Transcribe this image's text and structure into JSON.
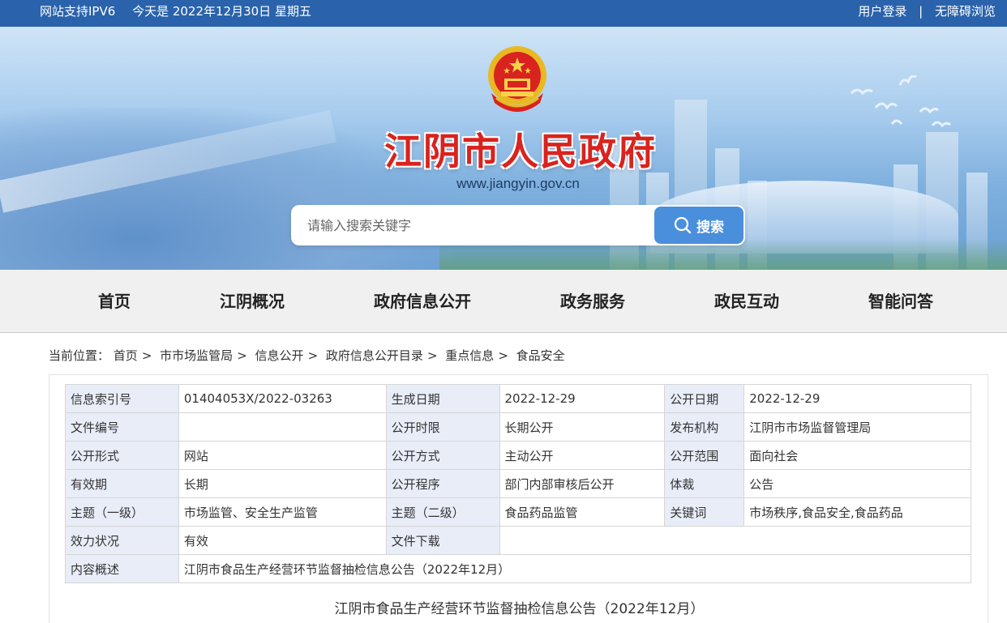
{
  "topbar": {
    "ipv6": "网站支持IPV6",
    "today": "今天是 2022年12月30日 星期五",
    "login": "用户登录",
    "separator": "|",
    "accessibility": "无障碍浏览"
  },
  "header": {
    "title": "江阴市人民政府",
    "url": "www.jiangyin.gov.cn"
  },
  "search": {
    "placeholder": "请输入搜索关键字",
    "button": "搜索"
  },
  "nav": [
    "首页",
    "江阴概况",
    "政府信息公开",
    "政务服务",
    "政民互动",
    "智能问答"
  ],
  "breadcrumb": {
    "label": "当前位置：",
    "items": [
      "首页",
      "市市场监管局",
      "信息公开",
      "政府信息公开目录",
      "重点信息",
      "食品安全"
    ],
    "sep": ">"
  },
  "meta": {
    "index_label": "信息索引号",
    "index_value": "01404053X/2022-03263",
    "gen_date_label": "生成日期",
    "gen_date_value": "2022-12-29",
    "pub_date_label": "公开日期",
    "pub_date_value": "2022-12-29",
    "doc_no_label": "文件编号",
    "doc_no_value": "",
    "period_label": "公开时限",
    "period_value": "长期公开",
    "org_label": "发布机构",
    "org_value": "江阴市市场监督管理局",
    "form_label": "公开形式",
    "form_value": "网站",
    "method_label": "公开方式",
    "method_value": "主动公开",
    "scope_label": "公开范围",
    "scope_value": "面向社会",
    "validity_label": "有效期",
    "validity_value": "长期",
    "procedure_label": "公开程序",
    "procedure_value": "部门内部审核后公开",
    "genre_label": "体裁",
    "genre_value": "公告",
    "topic1_label": "主题（一级）",
    "topic1_value": "市场监管、安全生产监管",
    "topic2_label": "主题（二级）",
    "topic2_value": "食品药品监管",
    "keywords_label": "关键词",
    "keywords_value": "市场秩序,食品安全,食品药品",
    "status_label": "效力状况",
    "status_value": "有效",
    "download_label": "文件下载",
    "download_value": "",
    "summary_label": "内容概述",
    "summary_value": "江阴市食品生产经营环节监督抽检信息公告（2022年12月）"
  },
  "article": {
    "title": "江阴市食品生产经营环节监督抽检信息公告（2022年12月）"
  },
  "colors": {
    "topbar": "#2a63ab",
    "title_red": "#d9231e",
    "search_button": "#4a8fdc",
    "table_key_bg": "#e8edf8"
  }
}
